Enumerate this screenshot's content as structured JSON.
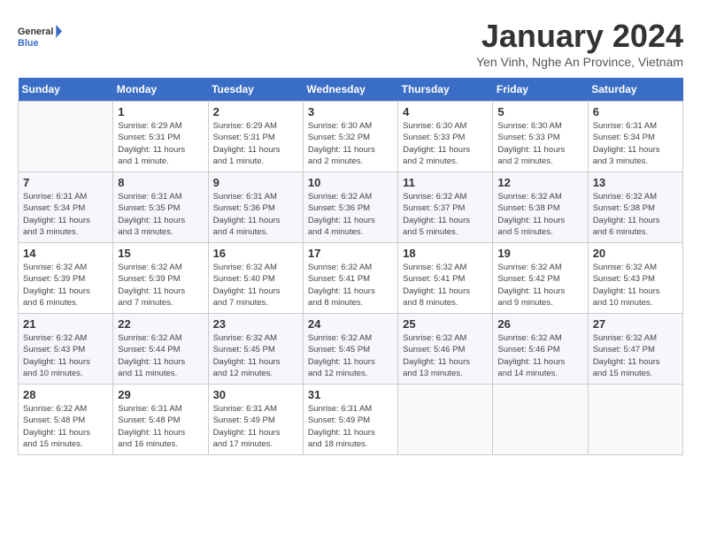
{
  "header": {
    "logo_text_top": "General",
    "logo_text_bottom": "Blue",
    "month_title": "January 2024",
    "location": "Yen Vinh, Nghe An Province, Vietnam"
  },
  "days_of_week": [
    "Sunday",
    "Monday",
    "Tuesday",
    "Wednesday",
    "Thursday",
    "Friday",
    "Saturday"
  ],
  "weeks": [
    [
      {
        "day": "",
        "info": ""
      },
      {
        "day": "1",
        "info": "Sunrise: 6:29 AM\nSunset: 5:31 PM\nDaylight: 11 hours\nand 1 minute."
      },
      {
        "day": "2",
        "info": "Sunrise: 6:29 AM\nSunset: 5:31 PM\nDaylight: 11 hours\nand 1 minute."
      },
      {
        "day": "3",
        "info": "Sunrise: 6:30 AM\nSunset: 5:32 PM\nDaylight: 11 hours\nand 2 minutes."
      },
      {
        "day": "4",
        "info": "Sunrise: 6:30 AM\nSunset: 5:33 PM\nDaylight: 11 hours\nand 2 minutes."
      },
      {
        "day": "5",
        "info": "Sunrise: 6:30 AM\nSunset: 5:33 PM\nDaylight: 11 hours\nand 2 minutes."
      },
      {
        "day": "6",
        "info": "Sunrise: 6:31 AM\nSunset: 5:34 PM\nDaylight: 11 hours\nand 3 minutes."
      }
    ],
    [
      {
        "day": "7",
        "info": "Sunrise: 6:31 AM\nSunset: 5:34 PM\nDaylight: 11 hours\nand 3 minutes."
      },
      {
        "day": "8",
        "info": "Sunrise: 6:31 AM\nSunset: 5:35 PM\nDaylight: 11 hours\nand 3 minutes."
      },
      {
        "day": "9",
        "info": "Sunrise: 6:31 AM\nSunset: 5:36 PM\nDaylight: 11 hours\nand 4 minutes."
      },
      {
        "day": "10",
        "info": "Sunrise: 6:32 AM\nSunset: 5:36 PM\nDaylight: 11 hours\nand 4 minutes."
      },
      {
        "day": "11",
        "info": "Sunrise: 6:32 AM\nSunset: 5:37 PM\nDaylight: 11 hours\nand 5 minutes."
      },
      {
        "day": "12",
        "info": "Sunrise: 6:32 AM\nSunset: 5:38 PM\nDaylight: 11 hours\nand 5 minutes."
      },
      {
        "day": "13",
        "info": "Sunrise: 6:32 AM\nSunset: 5:38 PM\nDaylight: 11 hours\nand 6 minutes."
      }
    ],
    [
      {
        "day": "14",
        "info": "Sunrise: 6:32 AM\nSunset: 5:39 PM\nDaylight: 11 hours\nand 6 minutes."
      },
      {
        "day": "15",
        "info": "Sunrise: 6:32 AM\nSunset: 5:39 PM\nDaylight: 11 hours\nand 7 minutes."
      },
      {
        "day": "16",
        "info": "Sunrise: 6:32 AM\nSunset: 5:40 PM\nDaylight: 11 hours\nand 7 minutes."
      },
      {
        "day": "17",
        "info": "Sunrise: 6:32 AM\nSunset: 5:41 PM\nDaylight: 11 hours\nand 8 minutes."
      },
      {
        "day": "18",
        "info": "Sunrise: 6:32 AM\nSunset: 5:41 PM\nDaylight: 11 hours\nand 8 minutes."
      },
      {
        "day": "19",
        "info": "Sunrise: 6:32 AM\nSunset: 5:42 PM\nDaylight: 11 hours\nand 9 minutes."
      },
      {
        "day": "20",
        "info": "Sunrise: 6:32 AM\nSunset: 5:43 PM\nDaylight: 11 hours\nand 10 minutes."
      }
    ],
    [
      {
        "day": "21",
        "info": "Sunrise: 6:32 AM\nSunset: 5:43 PM\nDaylight: 11 hours\nand 10 minutes."
      },
      {
        "day": "22",
        "info": "Sunrise: 6:32 AM\nSunset: 5:44 PM\nDaylight: 11 hours\nand 11 minutes."
      },
      {
        "day": "23",
        "info": "Sunrise: 6:32 AM\nSunset: 5:45 PM\nDaylight: 11 hours\nand 12 minutes."
      },
      {
        "day": "24",
        "info": "Sunrise: 6:32 AM\nSunset: 5:45 PM\nDaylight: 11 hours\nand 12 minutes."
      },
      {
        "day": "25",
        "info": "Sunrise: 6:32 AM\nSunset: 5:46 PM\nDaylight: 11 hours\nand 13 minutes."
      },
      {
        "day": "26",
        "info": "Sunrise: 6:32 AM\nSunset: 5:46 PM\nDaylight: 11 hours\nand 14 minutes."
      },
      {
        "day": "27",
        "info": "Sunrise: 6:32 AM\nSunset: 5:47 PM\nDaylight: 11 hours\nand 15 minutes."
      }
    ],
    [
      {
        "day": "28",
        "info": "Sunrise: 6:32 AM\nSunset: 5:48 PM\nDaylight: 11 hours\nand 15 minutes."
      },
      {
        "day": "29",
        "info": "Sunrise: 6:31 AM\nSunset: 5:48 PM\nDaylight: 11 hours\nand 16 minutes."
      },
      {
        "day": "30",
        "info": "Sunrise: 6:31 AM\nSunset: 5:49 PM\nDaylight: 11 hours\nand 17 minutes."
      },
      {
        "day": "31",
        "info": "Sunrise: 6:31 AM\nSunset: 5:49 PM\nDaylight: 11 hours\nand 18 minutes."
      },
      {
        "day": "",
        "info": ""
      },
      {
        "day": "",
        "info": ""
      },
      {
        "day": "",
        "info": ""
      }
    ]
  ]
}
